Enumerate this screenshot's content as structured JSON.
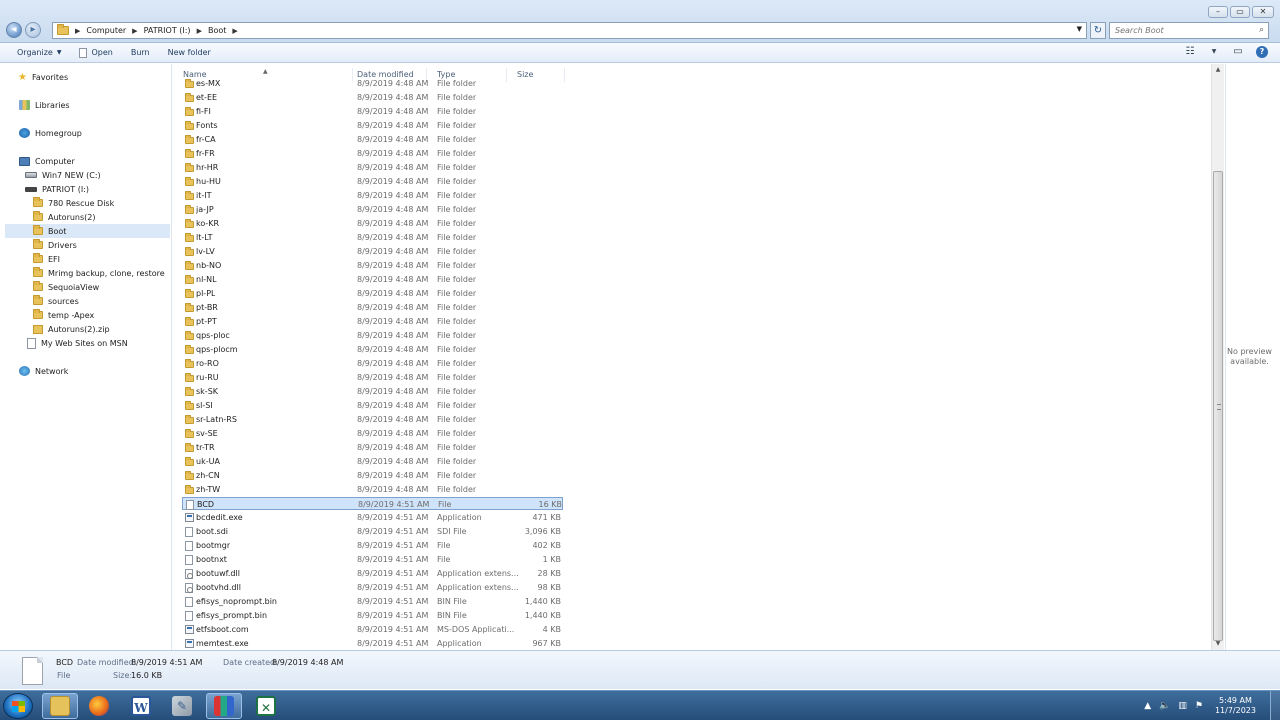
{
  "address": {
    "crumbs": [
      "Computer",
      "PATRIOT (I:)",
      "Boot"
    ]
  },
  "search": {
    "placeholder": "Search Boot"
  },
  "toolbar": {
    "organize_label": "Organize",
    "open_label": "Open",
    "burn_label": "Burn",
    "new_folder_label": "New folder"
  },
  "nav": {
    "favorites": "Favorites",
    "libraries": "Libraries",
    "homegroup": "Homegroup",
    "computer": "Computer",
    "drive_c": "Win7 NEW (C:)",
    "drive_i": "PATRIOT (I:)",
    "folders": [
      "780 Rescue Disk",
      "Autoruns(2)",
      "Boot",
      "Drivers",
      "EFI",
      "Mrimg backup, clone, restore",
      "SequoiaView",
      "sources",
      "temp -Apex"
    ],
    "zip": "Autoruns(2).zip",
    "msn": "My Web Sites on MSN",
    "network": "Network"
  },
  "columns": {
    "name": "Name",
    "date": "Date modified",
    "type": "Type",
    "size": "Size"
  },
  "files": [
    {
      "name": "es-MX",
      "date": "8/9/2019 4:48 AM",
      "type": "File folder",
      "size": "",
      "icon": "folder-icon"
    },
    {
      "name": "et-EE",
      "date": "8/9/2019 4:48 AM",
      "type": "File folder",
      "size": "",
      "icon": "folder-icon"
    },
    {
      "name": "fi-FI",
      "date": "8/9/2019 4:48 AM",
      "type": "File folder",
      "size": "",
      "icon": "folder-icon"
    },
    {
      "name": "Fonts",
      "date": "8/9/2019 4:48 AM",
      "type": "File folder",
      "size": "",
      "icon": "folder-icon"
    },
    {
      "name": "fr-CA",
      "date": "8/9/2019 4:48 AM",
      "type": "File folder",
      "size": "",
      "icon": "folder-icon"
    },
    {
      "name": "fr-FR",
      "date": "8/9/2019 4:48 AM",
      "type": "File folder",
      "size": "",
      "icon": "folder-icon"
    },
    {
      "name": "hr-HR",
      "date": "8/9/2019 4:48 AM",
      "type": "File folder",
      "size": "",
      "icon": "folder-icon"
    },
    {
      "name": "hu-HU",
      "date": "8/9/2019 4:48 AM",
      "type": "File folder",
      "size": "",
      "icon": "folder-icon"
    },
    {
      "name": "it-IT",
      "date": "8/9/2019 4:48 AM",
      "type": "File folder",
      "size": "",
      "icon": "folder-icon"
    },
    {
      "name": "ja-JP",
      "date": "8/9/2019 4:48 AM",
      "type": "File folder",
      "size": "",
      "icon": "folder-icon"
    },
    {
      "name": "ko-KR",
      "date": "8/9/2019 4:48 AM",
      "type": "File folder",
      "size": "",
      "icon": "folder-icon"
    },
    {
      "name": "lt-LT",
      "date": "8/9/2019 4:48 AM",
      "type": "File folder",
      "size": "",
      "icon": "folder-icon"
    },
    {
      "name": "lv-LV",
      "date": "8/9/2019 4:48 AM",
      "type": "File folder",
      "size": "",
      "icon": "folder-icon"
    },
    {
      "name": "nb-NO",
      "date": "8/9/2019 4:48 AM",
      "type": "File folder",
      "size": "",
      "icon": "folder-icon"
    },
    {
      "name": "nl-NL",
      "date": "8/9/2019 4:48 AM",
      "type": "File folder",
      "size": "",
      "icon": "folder-icon"
    },
    {
      "name": "pl-PL",
      "date": "8/9/2019 4:48 AM",
      "type": "File folder",
      "size": "",
      "icon": "folder-icon"
    },
    {
      "name": "pt-BR",
      "date": "8/9/2019 4:48 AM",
      "type": "File folder",
      "size": "",
      "icon": "folder-icon"
    },
    {
      "name": "pt-PT",
      "date": "8/9/2019 4:48 AM",
      "type": "File folder",
      "size": "",
      "icon": "folder-icon"
    },
    {
      "name": "qps-ploc",
      "date": "8/9/2019 4:48 AM",
      "type": "File folder",
      "size": "",
      "icon": "folder-icon"
    },
    {
      "name": "qps-plocm",
      "date": "8/9/2019 4:48 AM",
      "type": "File folder",
      "size": "",
      "icon": "folder-icon"
    },
    {
      "name": "ro-RO",
      "date": "8/9/2019 4:48 AM",
      "type": "File folder",
      "size": "",
      "icon": "folder-icon"
    },
    {
      "name": "ru-RU",
      "date": "8/9/2019 4:48 AM",
      "type": "File folder",
      "size": "",
      "icon": "folder-icon"
    },
    {
      "name": "sk-SK",
      "date": "8/9/2019 4:48 AM",
      "type": "File folder",
      "size": "",
      "icon": "folder-icon"
    },
    {
      "name": "sl-SI",
      "date": "8/9/2019 4:48 AM",
      "type": "File folder",
      "size": "",
      "icon": "folder-icon"
    },
    {
      "name": "sr-Latn-RS",
      "date": "8/9/2019 4:48 AM",
      "type": "File folder",
      "size": "",
      "icon": "folder-icon"
    },
    {
      "name": "sv-SE",
      "date": "8/9/2019 4:48 AM",
      "type": "File folder",
      "size": "",
      "icon": "folder-icon"
    },
    {
      "name": "tr-TR",
      "date": "8/9/2019 4:48 AM",
      "type": "File folder",
      "size": "",
      "icon": "folder-icon"
    },
    {
      "name": "uk-UA",
      "date": "8/9/2019 4:48 AM",
      "type": "File folder",
      "size": "",
      "icon": "folder-icon"
    },
    {
      "name": "zh-CN",
      "date": "8/9/2019 4:48 AM",
      "type": "File folder",
      "size": "",
      "icon": "folder-icon"
    },
    {
      "name": "zh-TW",
      "date": "8/9/2019 4:48 AM",
      "type": "File folder",
      "size": "",
      "icon": "folder-icon"
    },
    {
      "name": "BCD",
      "date": "8/9/2019 4:51 AM",
      "type": "File",
      "size": "16 KB",
      "icon": "file-icon",
      "selected": true
    },
    {
      "name": "bcdedit.exe",
      "date": "8/9/2019 4:51 AM",
      "type": "Application",
      "size": "471 KB",
      "icon": "exe-icon"
    },
    {
      "name": "boot.sdi",
      "date": "8/9/2019 4:51 AM",
      "type": "SDI File",
      "size": "3,096 KB",
      "icon": "file-icon"
    },
    {
      "name": "bootmgr",
      "date": "8/9/2019 4:51 AM",
      "type": "File",
      "size": "402 KB",
      "icon": "file-icon"
    },
    {
      "name": "bootnxt",
      "date": "8/9/2019 4:51 AM",
      "type": "File",
      "size": "1 KB",
      "icon": "file-icon"
    },
    {
      "name": "bootuwf.dll",
      "date": "8/9/2019 4:51 AM",
      "type": "Application extens...",
      "size": "28 KB",
      "icon": "dll-icon"
    },
    {
      "name": "bootvhd.dll",
      "date": "8/9/2019 4:51 AM",
      "type": "Application extens...",
      "size": "98 KB",
      "icon": "dll-icon"
    },
    {
      "name": "efisys_noprompt.bin",
      "date": "8/9/2019 4:51 AM",
      "type": "BIN File",
      "size": "1,440 KB",
      "icon": "file-icon"
    },
    {
      "name": "efisys_prompt.bin",
      "date": "8/9/2019 4:51 AM",
      "type": "BIN File",
      "size": "1,440 KB",
      "icon": "file-icon"
    },
    {
      "name": "etfsboot.com",
      "date": "8/9/2019 4:51 AM",
      "type": "MS-DOS Applicati...",
      "size": "4 KB",
      "icon": "exe-icon"
    },
    {
      "name": "memtest.exe",
      "date": "8/9/2019 4:51 AM",
      "type": "Application",
      "size": "967 KB",
      "icon": "exe-icon"
    }
  ],
  "preview": {
    "line1": "No preview",
    "line2": "available."
  },
  "details": {
    "name": "BCD",
    "kind": "File",
    "modified_label": "Date modified:",
    "modified_value": "8/9/2019 4:51 AM",
    "created_label": "Date created:",
    "created_value": "8/9/2019 4:48 AM",
    "size_label": "Size:",
    "size_value": "16.0 KB"
  },
  "taskbar": {
    "time": "5:49 AM",
    "date": "11/7/2023",
    "word_letter": "W"
  }
}
